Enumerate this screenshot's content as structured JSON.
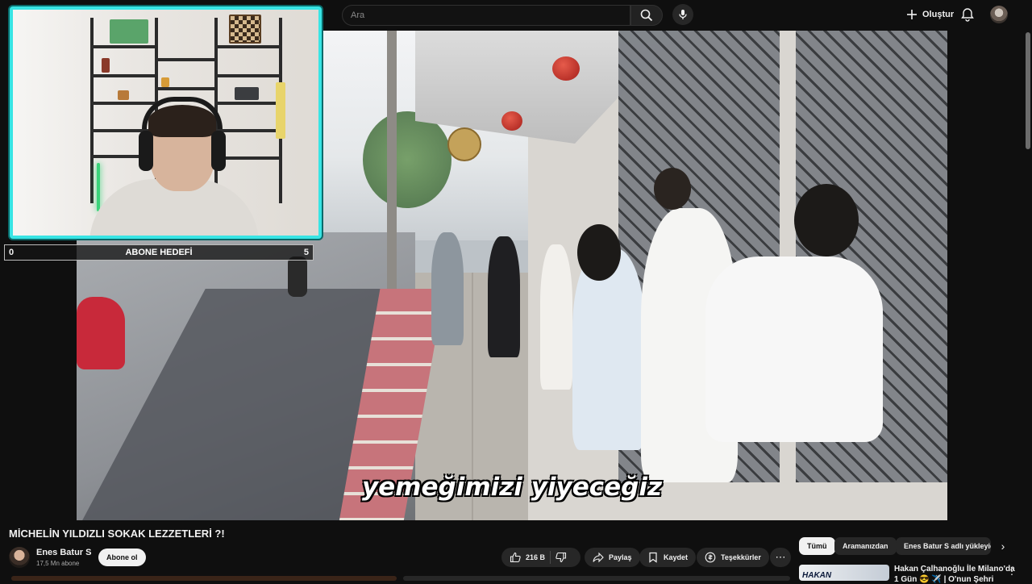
{
  "header": {
    "search_placeholder": "Ara",
    "create_label": "Oluştur"
  },
  "video": {
    "subtitle": "yemeğimizi yiyeceğiz",
    "title": "MİCHELİN YILDIZLI SOKAK LEZZETLERİ ?!"
  },
  "overlay": {
    "sub_goal_label": "ABONE HEDEFİ",
    "sub_goal_current": "0",
    "sub_goal_target": "5"
  },
  "channel": {
    "name": "Enes Batur S",
    "subscribers": "17,5 Mn abone",
    "subscribe_label": "Abone ol"
  },
  "actions": {
    "like_count": "216 B",
    "share_label": "Paylaş",
    "save_label": "Kaydet",
    "thanks_label": "Teşekkürler"
  },
  "filter_chips": [
    {
      "label": "Tümü",
      "active": true
    },
    {
      "label": "Aramanızdan",
      "active": false
    },
    {
      "label": "Enes Batur S adlı yükleyici",
      "active": false
    }
  ],
  "recommendation": {
    "thumb_text": "HAKAN",
    "title_line1": "Hakan Çalhanoğlu İle Milano'da",
    "title_line2": "1 Gün 😎 ✈️ | O'nun Şehri"
  },
  "colors": {
    "background": "#0f0f0f",
    "webcam_border": "#38e4e4",
    "chip_active": "#f1f1f1"
  }
}
